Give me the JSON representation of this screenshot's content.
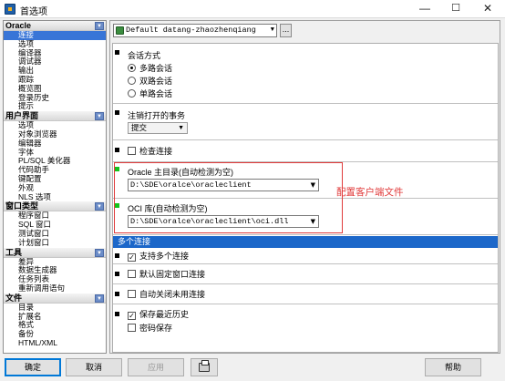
{
  "window": {
    "title": "首选项",
    "minimize": "—",
    "maximize": "☐",
    "close": "✕"
  },
  "sidebar": {
    "cat_oracle": "Oracle",
    "oracle_items": [
      "连接",
      "选项",
      "编译器",
      "调试器",
      "输出",
      "跟踪",
      "概览图",
      "登录历史",
      "提示"
    ],
    "cat_ui": "用户界面",
    "ui_items": [
      "选项",
      "对象浏览器",
      "编辑器",
      "字体",
      "PL/SQL 美化器",
      "代码助手",
      "键配置",
      "外观",
      "NLS 选项"
    ],
    "cat_window": "窗口类型",
    "window_items": [
      "程序窗口",
      "SQL 窗口",
      "测试窗口",
      "计划窗口"
    ],
    "cat_tools": "工具",
    "tools_items": [
      "差异",
      "数据生成器",
      "任务列表",
      "重新调用语句"
    ],
    "cat_files": "文件",
    "files_items": [
      "目录",
      "扩展名",
      "格式",
      "备份",
      "HTML/XML"
    ]
  },
  "toolbar": {
    "profile": "Default datang-zhaozhenqiang",
    "more": "..."
  },
  "session": {
    "title": "会话方式",
    "options": [
      "多路会话",
      "双路会话",
      "单路会话"
    ],
    "selected": "多路会话"
  },
  "logoff": {
    "title": "注销打开的事务",
    "value": "提交"
  },
  "check_connection": {
    "label": "检查连接",
    "checked": false
  },
  "oracle_home": {
    "title": "Oracle 主目录(自动检测为空)",
    "value": "D:\\SDE\\oralce\\oracleclient"
  },
  "oci_library": {
    "title": "OCI 库(自动检测为空)",
    "value": "D:\\SDE\\oralce\\oracleclient\\oci.dll"
  },
  "multi_connection": {
    "header": "多个连接",
    "support_multiple": {
      "label": "支持多个连接",
      "checked": true
    },
    "default_fixed_window": {
      "label": "默认固定窗口连接",
      "checked": false
    },
    "auto_close_unused": {
      "label": "自动关闭未用连接",
      "checked": false
    },
    "save_history": {
      "label": "保存最近历史",
      "checked": true
    },
    "save_password": {
      "label": "密码保存",
      "checked": false
    }
  },
  "annotation": {
    "text": "配置客户端文件",
    "color": "#e03b3b"
  },
  "buttons": {
    "ok": "确定",
    "cancel": "取消",
    "apply": "应用",
    "help": "帮助"
  },
  "colors": {
    "selection": "#3875d7",
    "section_header": "#1c67c9",
    "green_marker": "#15c21b"
  }
}
